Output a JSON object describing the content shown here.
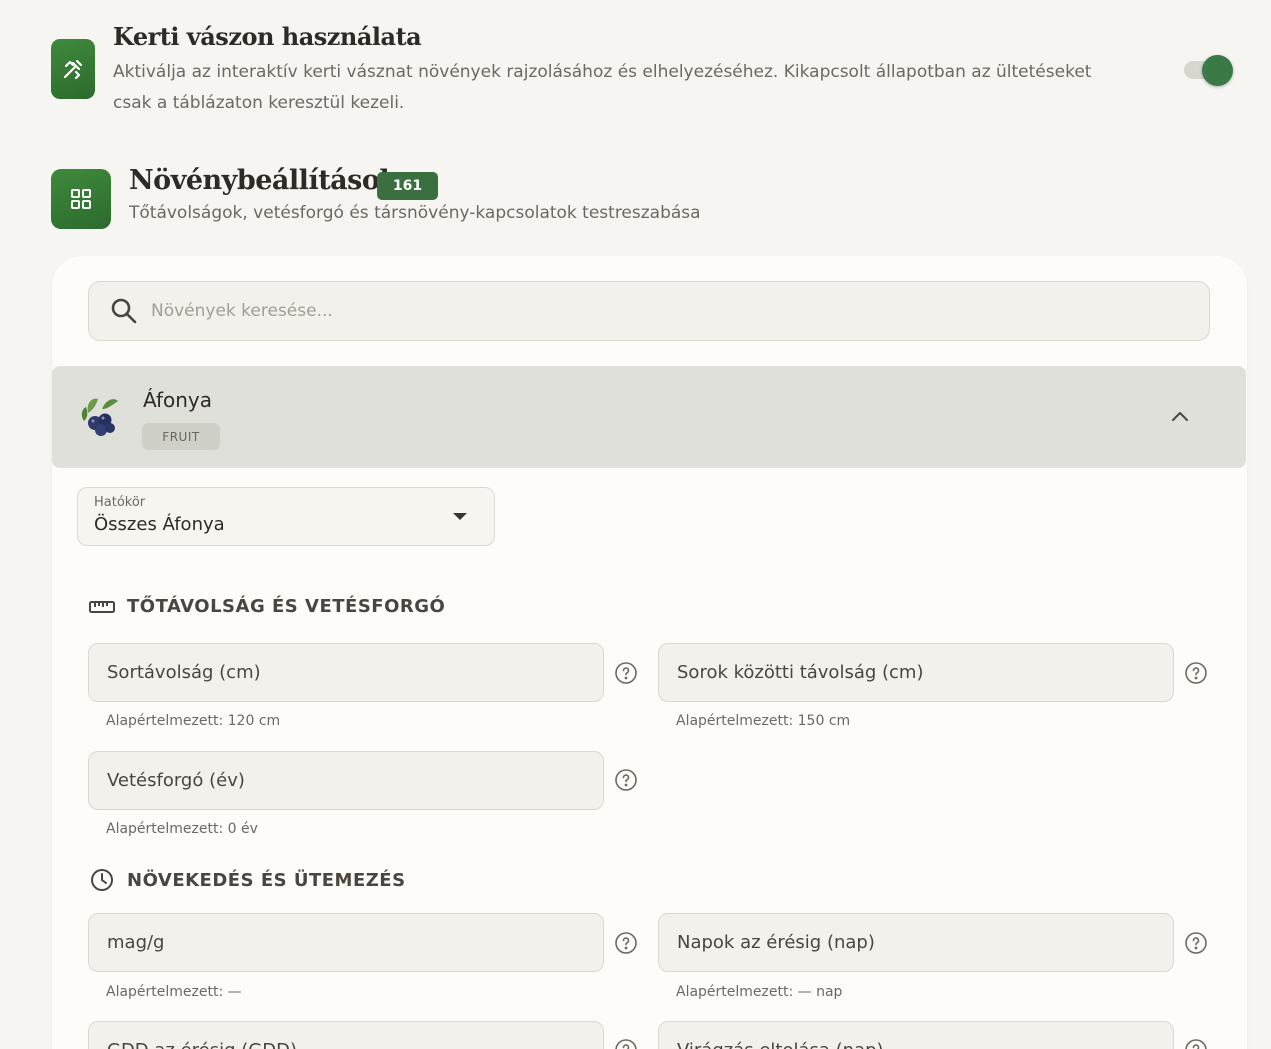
{
  "canvas_section": {
    "title": "Kerti vászon használata",
    "description": "Aktiválja az interaktív kerti vásznat növények rajzolásához és elhelyezéséhez. Kikapcsolt állapotban az ültetéseket csak a táblázaton keresztül kezeli.",
    "toggle_on": true,
    "icon": "pencil-ruler-icon"
  },
  "plants_section": {
    "title": "Növénybeállítások",
    "count": "161",
    "description": "Tőtávolságok, vetésforgó és társnövény-kapcsolatok testreszabása",
    "icon": "grid-icon"
  },
  "search": {
    "placeholder": "Növények keresése..."
  },
  "plant": {
    "name": "Áfonya",
    "category": "FRUIT",
    "icon": "blueberry-icon"
  },
  "scope": {
    "label": "Hatókör",
    "value": "Összes Áfonya"
  },
  "spacing_group": {
    "title": "TŐTÁVOLSÁG ÉS VETÉSFORGÓ",
    "fields": [
      {
        "label": "Sortávolság (cm)",
        "hint": "Alapértelmezett: 120 cm"
      },
      {
        "label": "Sorok közötti távolság (cm)",
        "hint": "Alapértelmezett: 150 cm"
      },
      {
        "label": "Vetésforgó (év)",
        "hint": "Alapértelmezett: 0 év"
      }
    ]
  },
  "growth_group": {
    "title": "NÖVEKEDÉS ÉS ÜTEMEZÉS",
    "fields": [
      {
        "label": "mag/g",
        "hint": "Alapértelmezett: —"
      },
      {
        "label": "Napok az érésig (nap)",
        "hint": "Alapértelmezett: — nap"
      },
      {
        "label": "GDD az érésig (GDD)"
      },
      {
        "label": "Virágzás eltolása (nap)"
      }
    ]
  },
  "colors": {
    "accent": "#3a6f3f",
    "background": "#f6f5f1",
    "card": "#fdfcf9",
    "selected_row": "#dfe0d9"
  }
}
